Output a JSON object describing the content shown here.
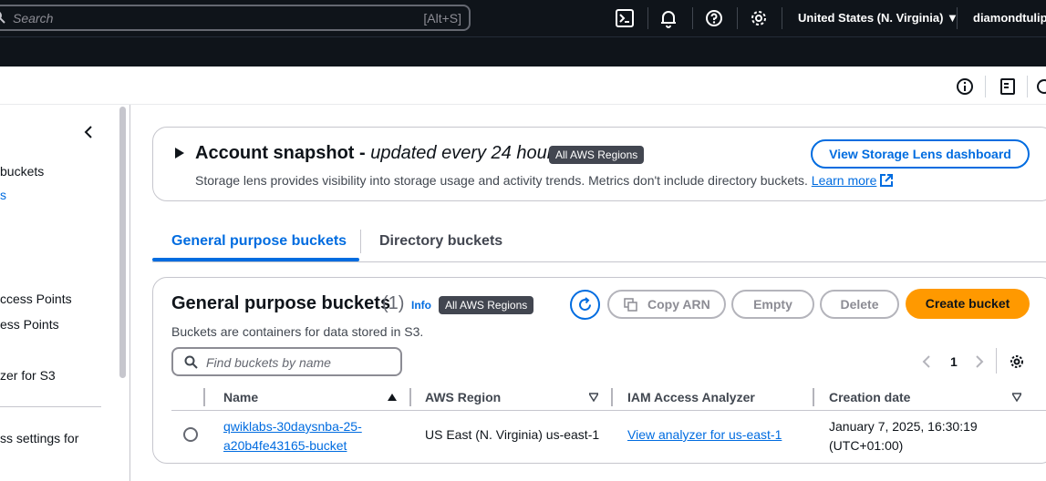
{
  "topnav": {
    "search_placeholder": "Search",
    "search_shortcut": "[Alt+S]",
    "icons": [
      "cloudshell-icon",
      "bell-icon",
      "help-icon",
      "gear-icon"
    ],
    "region": "United States (N. Virginia) ▼",
    "user": "diamondtulip"
  },
  "sidebar": {
    "items": [
      "buckets",
      "s",
      "ccess Points",
      "ess Points",
      "zer for S3",
      "ss settings for"
    ]
  },
  "snapshot": {
    "title": "Account snapshot - ",
    "title_italic": "updated every 24 hours",
    "badge": "All AWS Regions",
    "description": "Storage lens provides visibility into storage usage and activity trends. Metrics don't include directory buckets. ",
    "learn_more": "Learn more",
    "button": "View Storage Lens dashboard"
  },
  "tabs": [
    {
      "label": "General purpose buckets"
    },
    {
      "label": "Directory buckets"
    }
  ],
  "buckets": {
    "title": "General purpose buckets",
    "count": "(1)",
    "info": "Info",
    "badge": "All AWS Regions",
    "description": "Buckets are containers for data stored in S3.",
    "buttons": {
      "copy_arn": "Copy ARN",
      "empty": "Empty",
      "delete": "Delete",
      "create": "Create bucket"
    },
    "search_placeholder": "Find buckets by name",
    "page": "1",
    "columns": [
      "Name",
      "AWS Region",
      "IAM Access Analyzer",
      "Creation date"
    ],
    "rows": [
      {
        "name_line1": "qwiklabs-30daysnba-25-",
        "name_line2": "a20b4fe43165-bucket",
        "region": "US East (N. Virginia) us-east-1",
        "analyzer": "View analyzer for us-east-1",
        "date_line1": "January 7, 2025, 16:30:19",
        "date_line2": "(UTC+01:00)"
      }
    ]
  },
  "colors": {
    "nav_bg": "#0f141a",
    "link": "#006ce0",
    "primary": "#ff9900",
    "badge": "#424650"
  }
}
